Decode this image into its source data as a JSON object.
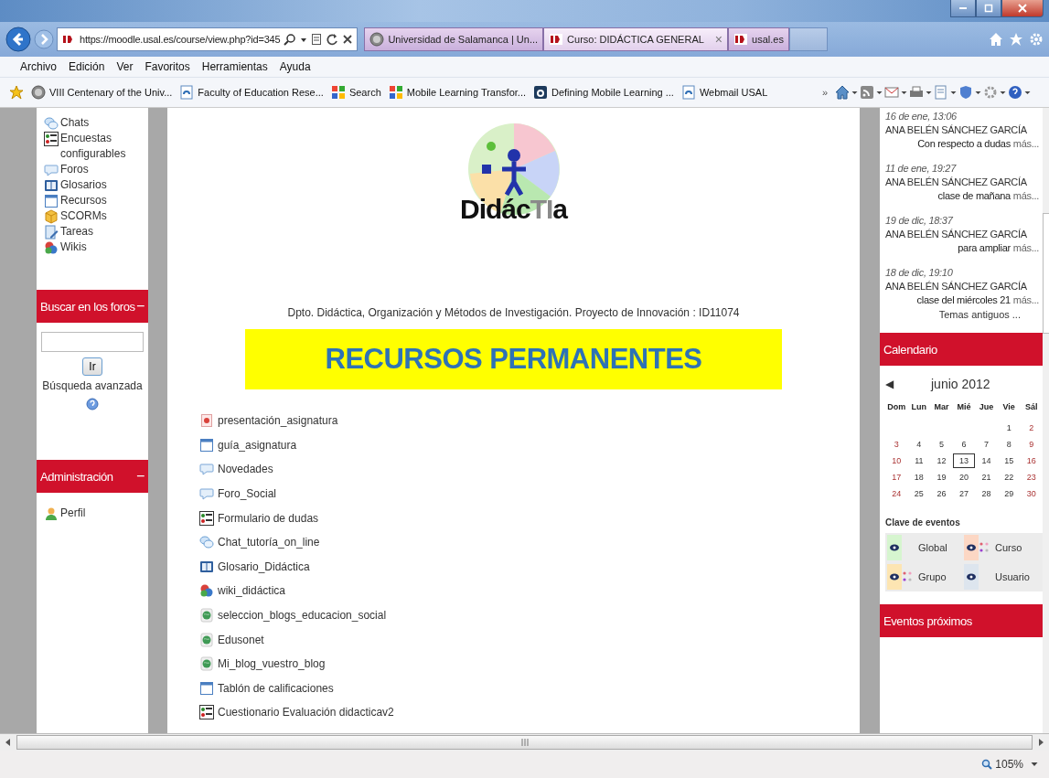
{
  "browser": {
    "address": "https://moodle.usal.es/course/view.php?id=345",
    "tabs": [
      {
        "label": "Universidad de Salamanca | Un...",
        "selected": false,
        "closable": false
      },
      {
        "label": "Curso: DIDÁCTICA GENERAL",
        "selected": true,
        "closable": true
      },
      {
        "label": "usal.es",
        "selected": false,
        "closable": false
      }
    ],
    "close_glyph": "×",
    "menu": [
      "Archivo",
      "Edición",
      "Ver",
      "Favoritos",
      "Herramientas",
      "Ayuda"
    ],
    "favorites": [
      "VIII Centenary of the Univ...",
      "Faculty of Education Rese...",
      "Search",
      "Mobile Learning Transfor...",
      "Defining Mobile Learning ...",
      "Webmail USAL"
    ],
    "chevron": "»",
    "zoom": "105%"
  },
  "left_column": {
    "activities": [
      {
        "label": "Chats",
        "kind": "chat"
      },
      {
        "label": "Encuestas configurables",
        "kind": "survey"
      },
      {
        "label": "Foros",
        "kind": "forum"
      },
      {
        "label": "Glosarios",
        "kind": "glossary"
      },
      {
        "label": "Recursos",
        "kind": "resource"
      },
      {
        "label": "SCORMs",
        "kind": "scorm"
      },
      {
        "label": "Tareas",
        "kind": "assignment"
      },
      {
        "label": "Wikis",
        "kind": "wiki"
      }
    ],
    "search_block": {
      "title": "Buscar en los foros",
      "collapse": "−",
      "button": "Ir",
      "advanced": "Búsqueda avanzada"
    },
    "admin_block": {
      "title": "Administración",
      "collapse": "−",
      "items": [
        {
          "label": "Perfil",
          "kind": "profile"
        }
      ]
    }
  },
  "main": {
    "logo_text": "Didác**TI**a",
    "department": "Dpto. Didáctica, Organización y Métodos de Investigación. Proyecto de Innovación : ID11074",
    "banner": "RECURSOS PERMANENTES",
    "resources": [
      {
        "label": "presentación_asignatura",
        "kind": "pdf"
      },
      {
        "label": "guía_asignatura",
        "kind": "resource"
      },
      {
        "label": "Novedades",
        "kind": "forum"
      },
      {
        "label": "Foro_Social",
        "kind": "forum"
      },
      {
        "label": "Formulario de dudas",
        "kind": "survey"
      },
      {
        "label": "Chat_tutoría_on_line",
        "kind": "chat"
      },
      {
        "label": "Glosario_Didáctica",
        "kind": "glossary"
      },
      {
        "label": "wiki_didáctica",
        "kind": "wiki"
      },
      {
        "label": "seleccion_blogs_educacion_social",
        "kind": "url"
      },
      {
        "label": "Edusonet",
        "kind": "url"
      },
      {
        "label": "Mi_blog_vuestro_blog",
        "kind": "url"
      },
      {
        "label": "Tablón de calificaciones",
        "kind": "resource"
      },
      {
        "label": "Cuestionario Evaluación didacticav2",
        "kind": "survey"
      }
    ]
  },
  "right_column": {
    "posts": [
      {
        "date": "16 de ene, 13:06",
        "author": "ANA BELÉN SÁNCHEZ GARCÍA",
        "text": "Con respecto a dudas",
        "more": "más..."
      },
      {
        "date": "11 de ene, 19:27",
        "author": "ANA BELÉN SÁNCHEZ GARCÍA",
        "text": "clase de mañana",
        "more": "más..."
      },
      {
        "date": "19 de dic, 18:37",
        "author": "ANA BELÉN SÁNCHEZ GARCÍA",
        "text": "para ampliar",
        "more": "más..."
      },
      {
        "date": "18 de dic, 19:10",
        "author": "ANA BELÉN SÁNCHEZ GARCÍA",
        "text": "clase del miércoles 21",
        "more": "más..."
      }
    ],
    "older": "Temas antiguos ...",
    "calendar": {
      "title": "Calendario",
      "prev": "◀",
      "month": "junio 2012",
      "weekdays": [
        "Dom",
        "Lun",
        "Mar",
        "Mié",
        "Jue",
        "Vie",
        "Sál"
      ],
      "weeks": [
        [
          {
            "day": "1",
            "today": false
          },
          {
            "day": "2",
            "today": false
          }
        ],
        [
          {
            "day": "3",
            "today": false
          },
          {
            "day": "4",
            "today": false
          },
          {
            "day": "5",
            "today": false
          },
          {
            "day": "6",
            "today": false
          },
          {
            "day": "7",
            "today": false
          },
          {
            "day": "8",
            "today": false
          },
          {
            "day": "9",
            "today": false
          }
        ],
        [
          {
            "day": "10",
            "today": false
          },
          {
            "day": "11",
            "today": false
          },
          {
            "day": "12",
            "today": false
          },
          {
            "day": "13",
            "today": true
          },
          {
            "day": "14",
            "today": false
          },
          {
            "day": "15",
            "today": false
          },
          {
            "day": "16",
            "today": false
          }
        ],
        [
          {
            "day": "17",
            "today": false
          },
          {
            "day": "18",
            "today": false
          },
          {
            "day": "19",
            "today": false
          },
          {
            "day": "20",
            "today": false
          },
          {
            "day": "21",
            "today": false
          },
          {
            "day": "22",
            "today": false
          },
          {
            "day": "23",
            "today": false
          }
        ],
        [
          {
            "day": "24",
            "today": false
          },
          {
            "day": "25",
            "today": false
          },
          {
            "day": "26",
            "today": false
          },
          {
            "day": "27",
            "today": false
          },
          {
            "day": "28",
            "today": false
          },
          {
            "day": "29",
            "today": false
          },
          {
            "day": "30",
            "today": false
          }
        ]
      ],
      "key_title": "Clave de eventos",
      "key": [
        {
          "label": "Global",
          "color": "#d6f5cf",
          "kind": "plain"
        },
        {
          "label": "Curso",
          "color": "#fcd7c4",
          "kind": "dotted"
        },
        {
          "label": "Grupo",
          "color": "#fde5b2",
          "kind": "dotted"
        },
        {
          "label": "Usuario",
          "color": "#dde5ee",
          "kind": "plain"
        }
      ]
    },
    "upcoming_title": "Eventos próximos"
  }
}
